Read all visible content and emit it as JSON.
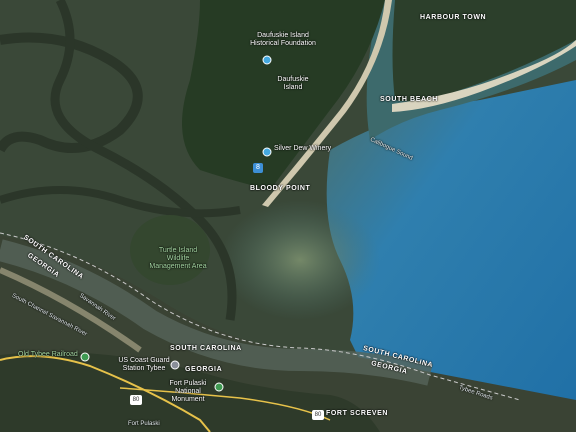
{
  "map": {
    "places": {
      "hilton_head_town": "HARBOUR TOWN",
      "south_beach": "SOUTH BEACH",
      "daufuskie_foundation": "Daufuskie Island Historical Foundation",
      "daufuskie_island": "Daufuskie Island",
      "silver_dew": "Silver Dew Winery",
      "bloody_point": "BLOODY POINT",
      "calibogue": "Calibogue Sound",
      "turtle_island": "Turtle Island Wildlife Management Area",
      "south_carolina_1": "SOUTH CAROLINA",
      "georgia_1": "GEORGIA",
      "south_carolina_2": "SOUTH CAROLINA",
      "south_carolina_3": "SOUTH CAROLINA",
      "georgia_2": "GEORGIA",
      "georgia_3": "GEORGIA",
      "old_tybee": "Old Tybee Railroad",
      "coast_guard": "US Coast Guard Station Tybee",
      "fort_pulaski": "Fort Pulaski National Monument",
      "fort_screven": "FORT SCREVEN",
      "tybee_roads": "Tybee Roads",
      "savannah_river": "Savannah River",
      "south_channel": "South Channel Savannah River",
      "fort_pulaski_road": "Fort Pulaski",
      "route_80": "80",
      "bloody_point_marker": "8"
    },
    "colors": {
      "ocean_deep": "#2a7fb6",
      "ocean_shallow": "#6a8d7a",
      "marsh": "#3a4a3c",
      "forest": "#243a22",
      "beach": "#d8d2bc",
      "road": "#e7c24a",
      "pin": "#45a9e0"
    },
    "icons": [
      "place-pin-icon",
      "monument-pin-icon",
      "park-pin-icon",
      "route-shield-icon",
      "bloody-point-marker-icon"
    ]
  }
}
